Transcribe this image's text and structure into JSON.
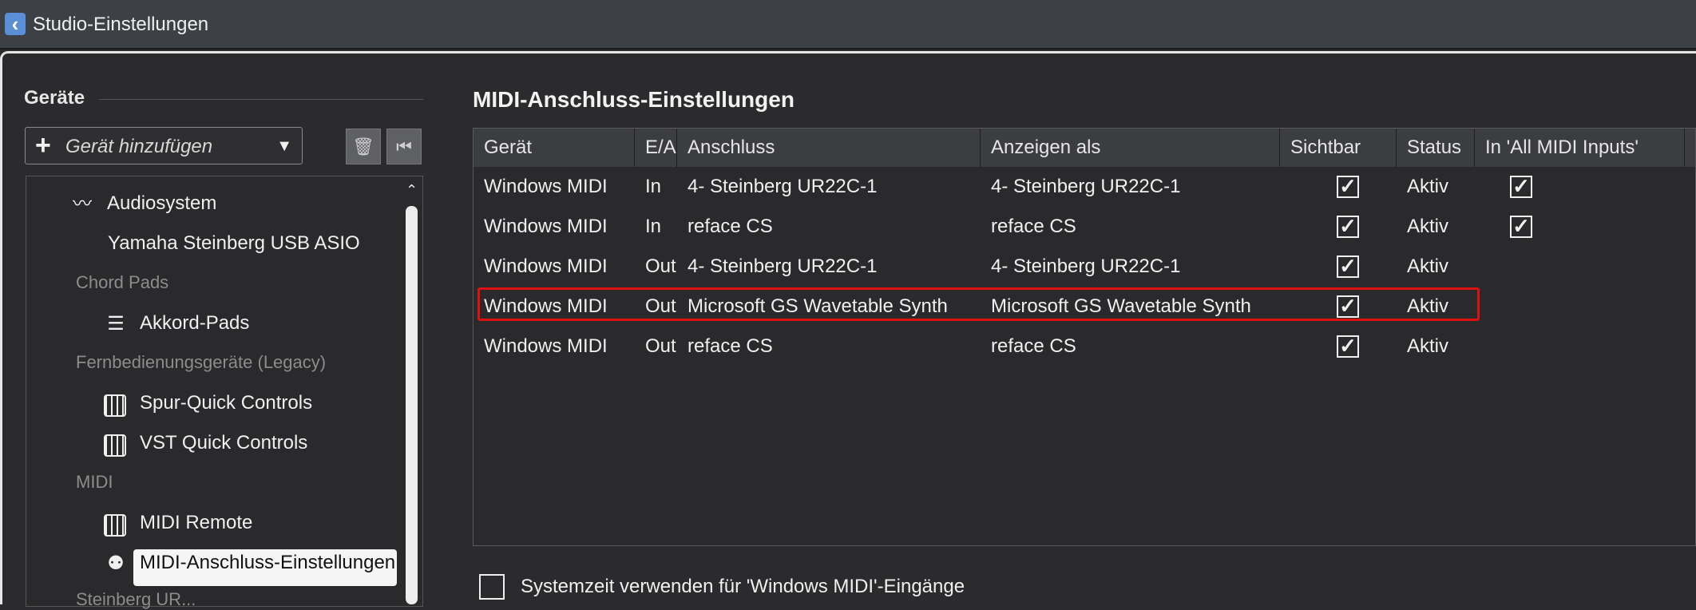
{
  "window": {
    "title": "Studio-Einstellungen"
  },
  "sidebar": {
    "header": "Geräte",
    "add_device_label": "Gerät hinzufügen",
    "tree": [
      {
        "kind": "item",
        "label": "Audiosystem",
        "icon": "audio-wave-icon"
      },
      {
        "kind": "sub",
        "label": "Yamaha Steinberg USB ASIO"
      },
      {
        "kind": "category",
        "label": "Chord Pads"
      },
      {
        "kind": "item",
        "label": "Akkord-Pads",
        "icon": "sliders-icon"
      },
      {
        "kind": "category",
        "label": "Fernbedienungsgeräte (Legacy)"
      },
      {
        "kind": "item",
        "label": "Spur-Quick Controls",
        "icon": "piano-icon"
      },
      {
        "kind": "item",
        "label": "VST Quick Controls",
        "icon": "piano-icon"
      },
      {
        "kind": "category",
        "label": "MIDI"
      },
      {
        "kind": "item",
        "label": "MIDI Remote",
        "icon": "piano-icon"
      },
      {
        "kind": "item",
        "label": "MIDI-Anschluss-Einstellungen",
        "icon": "midi-port-icon",
        "selected": true
      },
      {
        "kind": "category",
        "label": "Steinberg UR..."
      }
    ]
  },
  "main": {
    "title": "MIDI-Anschluss-Einstellungen",
    "columns": [
      "Gerät",
      "E/A",
      "Anschluss",
      "Anzeigen als",
      "Sichtbar",
      "Status",
      "In 'All MIDI Inputs'"
    ],
    "rows": [
      {
        "device": "Windows MIDI",
        "io": "In",
        "port": "4- Steinberg UR22C-1",
        "show_as": "4- Steinberg UR22C-1",
        "visible": true,
        "status": "Aktiv",
        "all_inputs": true
      },
      {
        "device": "Windows MIDI",
        "io": "In",
        "port": "reface CS",
        "show_as": "reface CS",
        "visible": true,
        "status": "Aktiv",
        "all_inputs": true
      },
      {
        "device": "Windows MIDI",
        "io": "Out",
        "port": "4- Steinberg UR22C-1",
        "show_as": "4- Steinberg UR22C-1",
        "visible": true,
        "status": "Aktiv",
        "all_inputs": false
      },
      {
        "device": "Windows MIDI",
        "io": "Out",
        "port": "Microsoft GS Wavetable Synth",
        "show_as": "Microsoft GS Wavetable Synth",
        "visible": true,
        "status": "Aktiv",
        "all_inputs": false,
        "highlighted": true
      },
      {
        "device": "Windows MIDI",
        "io": "Out",
        "port": "reface CS",
        "show_as": "reface CS",
        "visible": true,
        "status": "Aktiv",
        "all_inputs": false
      }
    ],
    "system_time_label": "Systemzeit verwenden für 'Windows MIDI'-Eingänge",
    "system_time_checked": false
  },
  "colors": {
    "highlight": "#e01010",
    "background": "#2b2b2e",
    "header": "#3c3d41"
  }
}
